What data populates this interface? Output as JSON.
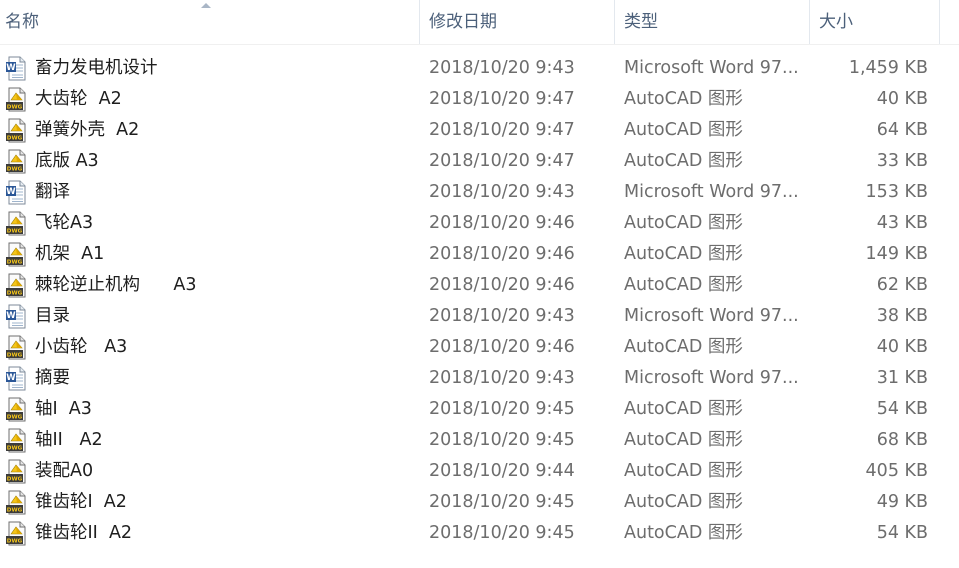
{
  "columns": {
    "name": "名称",
    "date": "修改日期",
    "type": "类型",
    "size": "大小"
  },
  "icons": {
    "doc": "word-document-icon",
    "dwg": "autocad-drawing-icon"
  },
  "files": [
    {
      "name": "畜力发电机设计",
      "date": "2018/10/20 9:43",
      "type": "Microsoft Word 97...",
      "size": "1,459 KB",
      "icon": "doc"
    },
    {
      "name": "大齿轮  A2",
      "date": "2018/10/20 9:47",
      "type": "AutoCAD 图形",
      "size": "40 KB",
      "icon": "dwg"
    },
    {
      "name": "弹簧外壳  A2",
      "date": "2018/10/20 9:47",
      "type": "AutoCAD 图形",
      "size": "64 KB",
      "icon": "dwg"
    },
    {
      "name": "底版 A3",
      "date": "2018/10/20 9:47",
      "type": "AutoCAD 图形",
      "size": "33 KB",
      "icon": "dwg"
    },
    {
      "name": "翻译",
      "date": "2018/10/20 9:43",
      "type": "Microsoft Word 97...",
      "size": "153 KB",
      "icon": "doc"
    },
    {
      "name": "飞轮A3",
      "date": "2018/10/20 9:46",
      "type": "AutoCAD 图形",
      "size": "43 KB",
      "icon": "dwg"
    },
    {
      "name": "机架  A1",
      "date": "2018/10/20 9:46",
      "type": "AutoCAD 图形",
      "size": "149 KB",
      "icon": "dwg"
    },
    {
      "name": "棘轮逆止机构      A3",
      "date": "2018/10/20 9:46",
      "type": "AutoCAD 图形",
      "size": "62 KB",
      "icon": "dwg"
    },
    {
      "name": "目录",
      "date": "2018/10/20 9:43",
      "type": "Microsoft Word 97...",
      "size": "38 KB",
      "icon": "doc"
    },
    {
      "name": "小齿轮   A3",
      "date": "2018/10/20 9:46",
      "type": "AutoCAD 图形",
      "size": "40 KB",
      "icon": "dwg"
    },
    {
      "name": "摘要",
      "date": "2018/10/20 9:43",
      "type": "Microsoft Word 97...",
      "size": "31 KB",
      "icon": "doc"
    },
    {
      "name": "轴I  A3",
      "date": "2018/10/20 9:45",
      "type": "AutoCAD 图形",
      "size": "54 KB",
      "icon": "dwg"
    },
    {
      "name": "轴II   A2",
      "date": "2018/10/20 9:45",
      "type": "AutoCAD 图形",
      "size": "68 KB",
      "icon": "dwg"
    },
    {
      "name": "装配A0",
      "date": "2018/10/20 9:44",
      "type": "AutoCAD 图形",
      "size": "405 KB",
      "icon": "dwg"
    },
    {
      "name": "锥齿轮I  A2",
      "date": "2018/10/20 9:45",
      "type": "AutoCAD 图形",
      "size": "49 KB",
      "icon": "dwg"
    },
    {
      "name": "锥齿轮II  A2",
      "date": "2018/10/20 9:45",
      "type": "AutoCAD 图形",
      "size": "54 KB",
      "icon": "dwg"
    }
  ]
}
